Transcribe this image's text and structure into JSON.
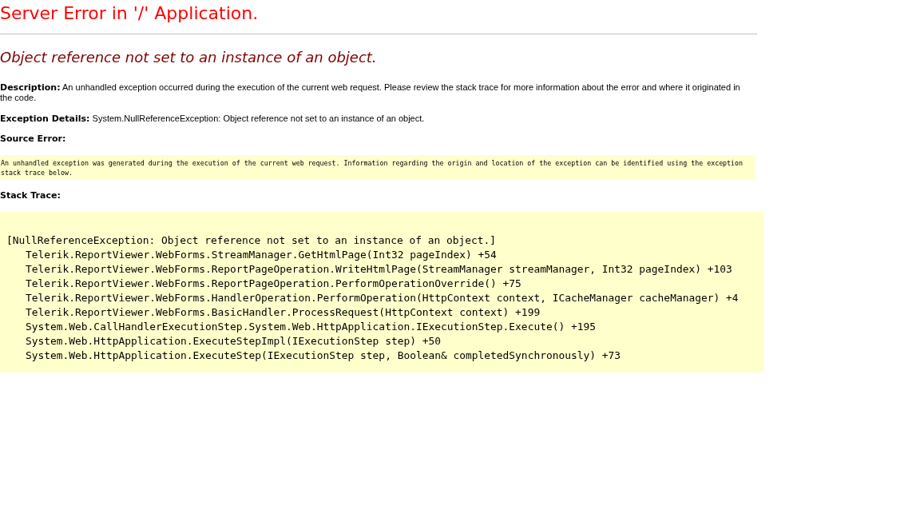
{
  "title": "Server Error in '/' Application.",
  "heading": "Object reference not set to an instance of an object.",
  "description": {
    "label": "Description:",
    "text": "An unhandled exception occurred during the execution of the current web request. Please review the stack trace for more information about the error and where it originated in the code."
  },
  "exception_details": {
    "label": "Exception Details:",
    "text": "System.NullReferenceException: Object reference not set to an instance of an object."
  },
  "source_error": {
    "label": "Source Error:",
    "text": "An unhandled exception was generated during the execution of the current web request. Information regarding the origin and location of the exception can be identified using the exception stack trace below."
  },
  "stack_trace": {
    "label": "Stack Trace:",
    "exception": "[NullReferenceException: Object reference not set to an instance of an object.]",
    "frames": [
      "Telerik.ReportViewer.WebForms.StreamManager.GetHtmlPage(Int32 pageIndex) +54",
      "Telerik.ReportViewer.WebForms.ReportPageOperation.WriteHtmlPage(StreamManager streamManager, Int32 pageIndex) +103",
      "Telerik.ReportViewer.WebForms.ReportPageOperation.PerformOperationOverride() +75",
      "Telerik.ReportViewer.WebForms.HandlerOperation.PerformOperation(HttpContext context, ICacheManager cacheManager) +4",
      "Telerik.ReportViewer.WebForms.BasicHandler.ProcessRequest(HttpContext context) +199",
      "System.Web.CallHandlerExecutionStep.System.Web.HttpApplication.IExecutionStep.Execute() +195",
      "System.Web.HttpApplication.ExecuteStepImpl(IExecutionStep step) +50",
      "System.Web.HttpApplication.ExecuteStep(IExecutionStep step, Boolean& completedSynchronously) +73"
    ]
  }
}
